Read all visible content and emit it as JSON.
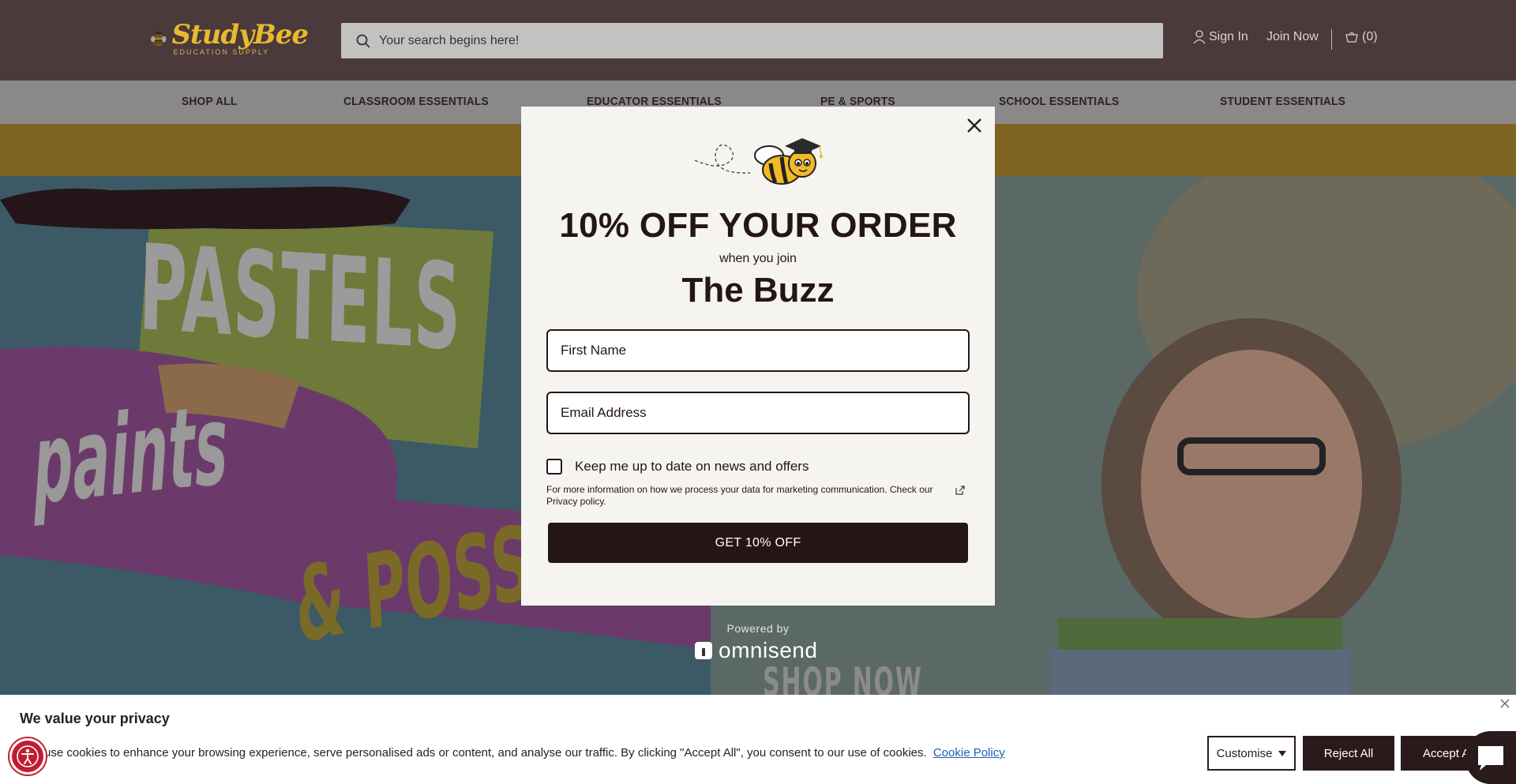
{
  "header": {
    "logo": {
      "main": "StudyBee",
      "sub": "EDUCATION SUPPLY"
    },
    "search": {
      "placeholder": "Your search begins here!"
    },
    "account": {
      "sign_in": "Sign In",
      "join_now": "Join Now",
      "cart_count": "(0)"
    }
  },
  "nav": {
    "items": [
      "SHOP ALL",
      "CLASSROOM ESSENTIALS",
      "EDUCATOR ESSENTIALS",
      "PE & SPORTS",
      "SCHOOL ESSENTIALS",
      "STUDENT ESSENTIALS"
    ]
  },
  "hero": {
    "line1": "PASTELS",
    "line2": "paints",
    "line3": "& POSSIBILITIES",
    "cta": "SHOP NOW"
  },
  "modal": {
    "title": "10% OFF YOUR ORDER",
    "subtitle": "when you join",
    "brand": "The Buzz",
    "first_name_placeholder": "First Name",
    "email_placeholder": "Email Address",
    "consent_label": "Keep me up to date on news and offers",
    "privacy_text": "For more information on how we process your data for marketing communication. Check our Privacy policy.",
    "cta": "GET 10% OFF",
    "powered_by": "Powered by",
    "powered_brand": "omnisend"
  },
  "cookie": {
    "title": "We value your privacy",
    "text": "use cookies to enhance your browsing experience, serve personalised ads or content, and analyse our traffic. By clicking \"Accept All\", you consent to our use of cookies.",
    "link": "Cookie Policy",
    "customise": "Customise",
    "reject": "Reject All",
    "accept": "Accept All"
  },
  "colors": {
    "header_bg": "#4a3a3c",
    "brand_gold": "#e9b92e",
    "dark_button": "#251517",
    "a11y_red": "#c01d31"
  }
}
